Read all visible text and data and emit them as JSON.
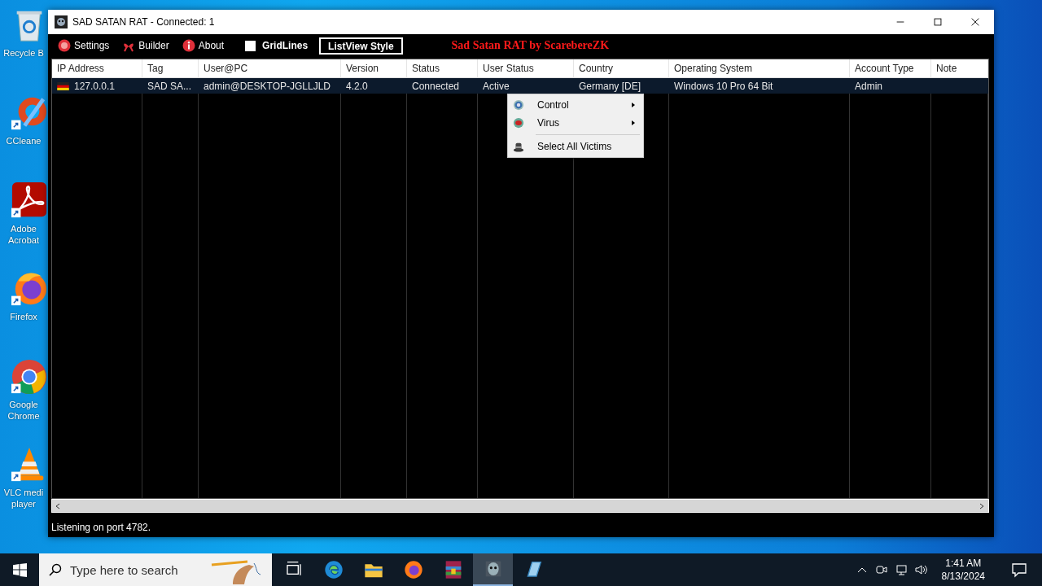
{
  "desktop_icons": [
    {
      "kind": "recycle",
      "label": "Recycle B"
    },
    {
      "kind": "ccleaner",
      "label": "CCleane"
    },
    {
      "kind": "acrobat",
      "label": "Adobe Acrobat"
    },
    {
      "kind": "firefox",
      "label": "Firefox"
    },
    {
      "kind": "chrome",
      "label": "Google Chrome"
    },
    {
      "kind": "vlc",
      "label": "VLC medi player"
    }
  ],
  "window": {
    "title": "SAD SATAN RAT - Connected: 1",
    "toolbar": [
      {
        "kind": "settings",
        "label": "Settings"
      },
      {
        "kind": "builder",
        "label": "Builder"
      },
      {
        "kind": "about",
        "label": "About"
      }
    ],
    "gridlines": {
      "label": "GridLines",
      "checked": false
    },
    "style_button": "ListView Style",
    "banner": "Sad Satan RAT by ScarebereZK",
    "table": {
      "columns": [
        "IP Address",
        "Tag",
        "User@PC",
        "Version",
        "Status",
        "User Status",
        "Country",
        "Operating System",
        "Account Type",
        "Note"
      ],
      "rows": [
        {
          "selected": true,
          "cells": [
            "127.0.0.1",
            "SAD SA...",
            "admin@DESKTOP-JGLLJLD",
            "4.2.0",
            "Connected",
            "Active",
            "Germany [DE]",
            "Windows 10 Pro 64 Bit",
            "Admin"
          ]
        }
      ]
    },
    "context_menu": [
      {
        "kind": "control",
        "label": "Control",
        "submenu": true
      },
      {
        "kind": "virus",
        "label": "Virus",
        "submenu": true
      },
      {
        "kind": "separator"
      },
      {
        "kind": "select",
        "label": "Select All Victims",
        "submenu": false
      }
    ],
    "status_bar": "Listening on port 4782."
  },
  "taskbar": {
    "search_placeholder": "Type here to search",
    "apps": [
      {
        "kind": "taskview",
        "selected": false
      },
      {
        "kind": "edge",
        "selected": false
      },
      {
        "kind": "explorer",
        "selected": false
      },
      {
        "kind": "firefox",
        "selected": false
      },
      {
        "kind": "winrar",
        "selected": false
      },
      {
        "kind": "ghost",
        "selected": true
      },
      {
        "kind": "notepad",
        "selected": false
      }
    ],
    "time": "1:41 AM",
    "date": "8/13/2024"
  }
}
